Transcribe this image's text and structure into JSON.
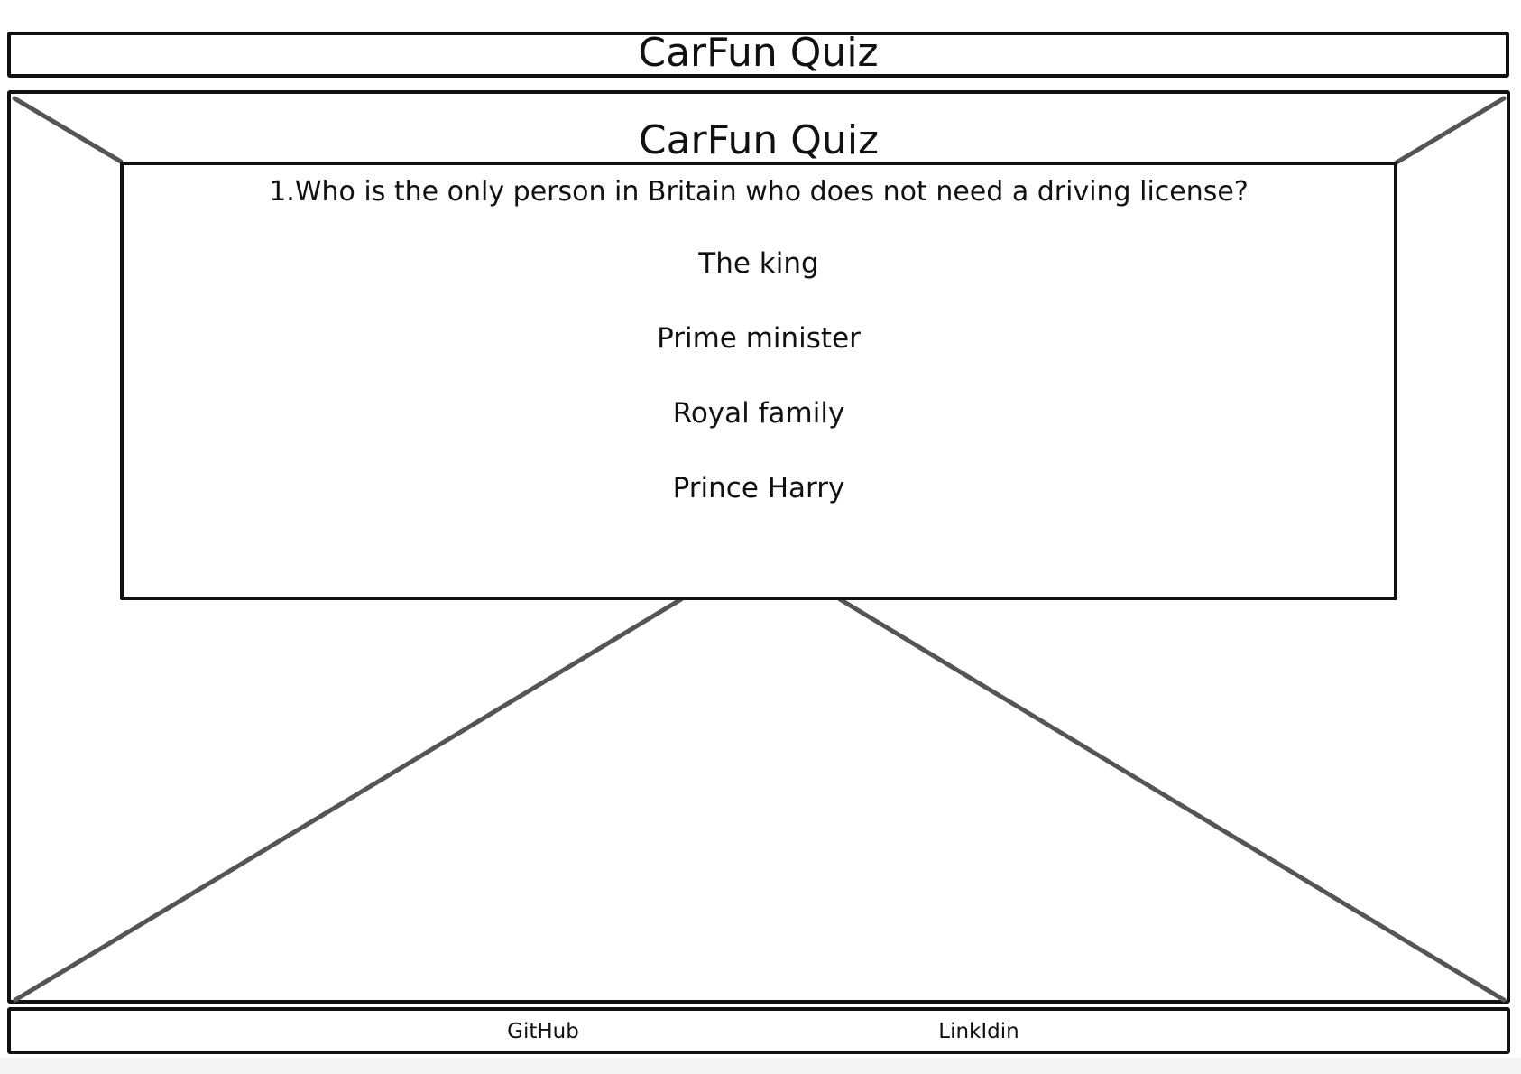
{
  "header": {
    "title": "CarFun Quiz"
  },
  "hero": {
    "title": "CarFun Quiz"
  },
  "quiz": {
    "question": "1.Who is the only person in Britain who does not need a driving license?",
    "answers": [
      "The king",
      "Prime minister",
      "Royal family",
      "Prince Harry"
    ]
  },
  "footer": {
    "links": [
      "GitHub",
      "LinkIdin"
    ]
  },
  "colors": {
    "line": "#111111",
    "placeholder_cross": "#555555",
    "background": "#ffffff"
  }
}
